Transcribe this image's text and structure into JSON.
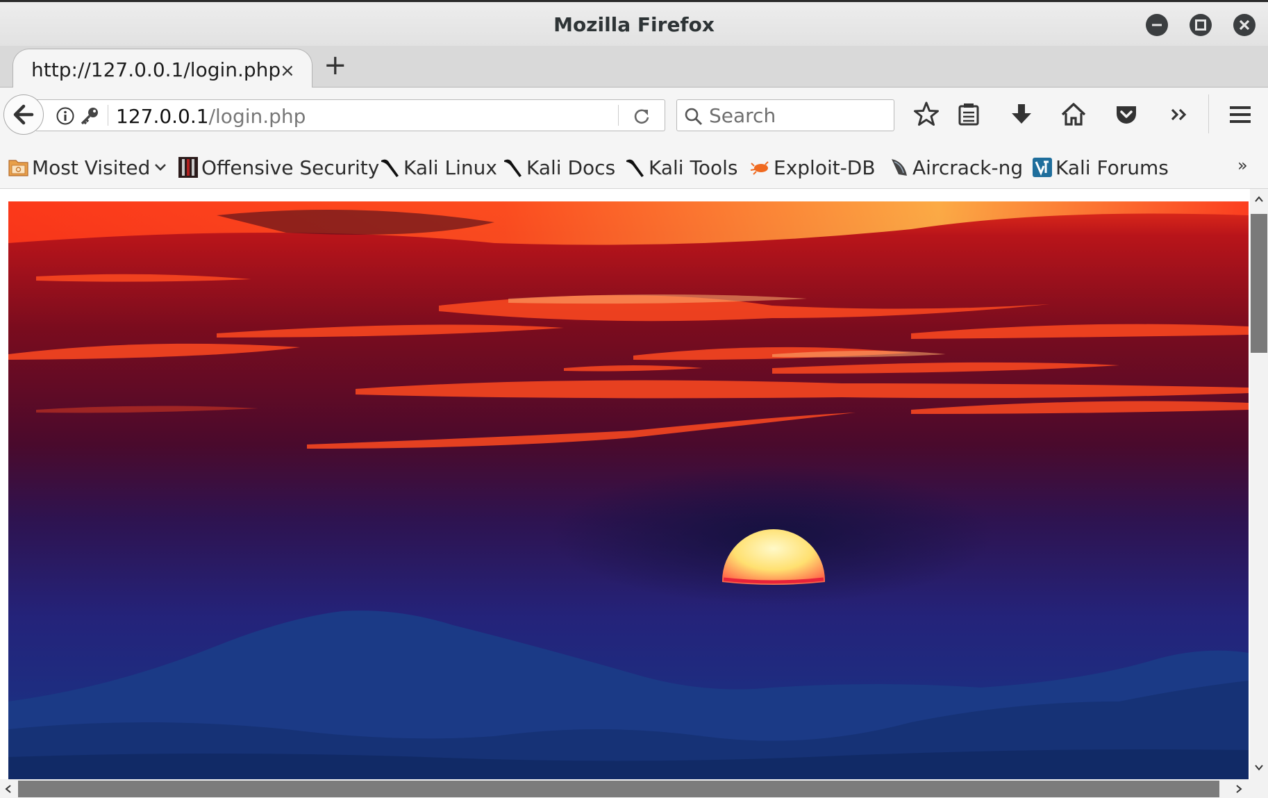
{
  "window": {
    "title": "Mozilla Firefox",
    "buttons": [
      "minimize",
      "maximize",
      "close"
    ]
  },
  "tabs": [
    {
      "title": "http://127.0.0.1/login.php",
      "active": true
    }
  ],
  "new_tab_label": "+",
  "tab_close_label": "×",
  "urlbar": {
    "host": "127.0.0.1",
    "path": "/login.php"
  },
  "search": {
    "placeholder": "Search"
  },
  "bookmarks": [
    {
      "label": "Most Visited",
      "icon": "folder-icon"
    },
    {
      "label": "Offensive Security",
      "icon": "offsec-icon"
    },
    {
      "label": "Kali Linux",
      "icon": "kali-dragon-icon"
    },
    {
      "label": "Kali Docs",
      "icon": "kali-dragon-icon"
    },
    {
      "label": "Kali Tools",
      "icon": "kali-dragon-icon"
    },
    {
      "label": "Exploit-DB",
      "icon": "exploit-db-icon"
    },
    {
      "label": "Aircrack-ng",
      "icon": "aircrack-icon"
    },
    {
      "label": "Kali Forums",
      "icon": "kali-forums-icon"
    }
  ],
  "bookmarks_overflow": "»",
  "toolbar_icons": [
    "bookmark-star-icon",
    "reading-list-icon",
    "download-icon",
    "home-icon",
    "pocket-icon",
    "overflow-icon",
    "menu-icon"
  ],
  "page": {
    "image": "sunset-over-mountains-photo"
  },
  "colors": {
    "chrome": "#ececec",
    "toolbar": "#f5f5f5",
    "scroll_thumb": "#7a7a7a"
  }
}
